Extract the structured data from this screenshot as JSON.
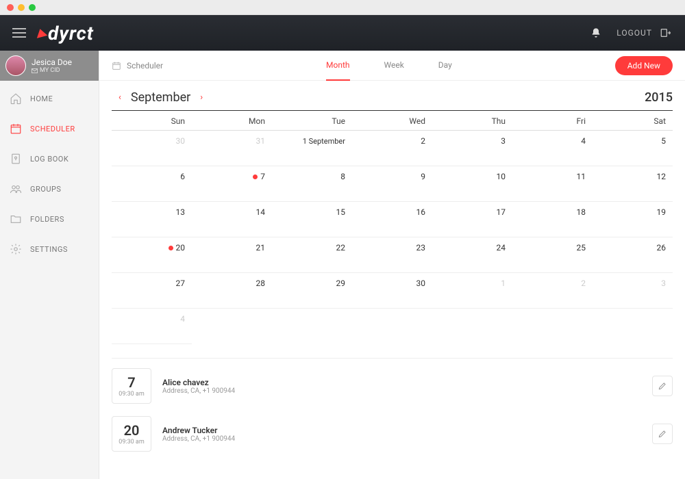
{
  "brand": "dyrct",
  "topbar": {
    "logout": "LOGOUT"
  },
  "user": {
    "name": "Jesica Doe",
    "sub": "MY CID"
  },
  "nav": {
    "home": "HOME",
    "scheduler": "SCHEDULER",
    "logbook": "LOG BOOK",
    "groups": "GROUPS",
    "folders": "FOLDERS",
    "settings": "SETTINGS"
  },
  "subheader": {
    "title": "Scheduler",
    "tabs": {
      "month": "Month",
      "week": "Week",
      "day": "Day"
    },
    "add": "Add New"
  },
  "calendar": {
    "month": "September",
    "year": "2015",
    "days": [
      "Sun",
      "Mon",
      "Tue",
      "Wed",
      "Thu",
      "Fri",
      "Sat"
    ],
    "cells": [
      {
        "n": "30",
        "dim": true
      },
      {
        "n": "31",
        "dim": true
      },
      {
        "label": "1 September"
      },
      {
        "n": "2"
      },
      {
        "n": "3"
      },
      {
        "n": "4"
      },
      {
        "n": "5"
      },
      {
        "n": "6"
      },
      {
        "n": "7",
        "ev": true
      },
      {
        "n": "8"
      },
      {
        "n": "9"
      },
      {
        "n": "10"
      },
      {
        "n": "11"
      },
      {
        "n": "12"
      },
      {
        "n": "13"
      },
      {
        "n": "14"
      },
      {
        "n": "15"
      },
      {
        "n": "16"
      },
      {
        "n": "17"
      },
      {
        "n": "18"
      },
      {
        "n": "19"
      },
      {
        "n": "20",
        "ev": true
      },
      {
        "n": "21"
      },
      {
        "n": "22"
      },
      {
        "n": "23"
      },
      {
        "n": "24"
      },
      {
        "n": "25"
      },
      {
        "n": "26"
      },
      {
        "n": "27"
      },
      {
        "n": "28"
      },
      {
        "n": "29"
      },
      {
        "n": "30"
      },
      {
        "n": "1",
        "dim": true
      },
      {
        "n": "2",
        "dim": true
      },
      {
        "n": "3",
        "dim": true
      },
      {
        "n": "4",
        "dim": true
      }
    ]
  },
  "events": [
    {
      "day": "7",
      "time": "09:30 am",
      "name": "Alice chavez",
      "addr": "Address, CA, +1 900944"
    },
    {
      "day": "20",
      "time": "09:30 am",
      "name": "Andrew Tucker",
      "addr": "Address, CA, +1 900944"
    }
  ]
}
